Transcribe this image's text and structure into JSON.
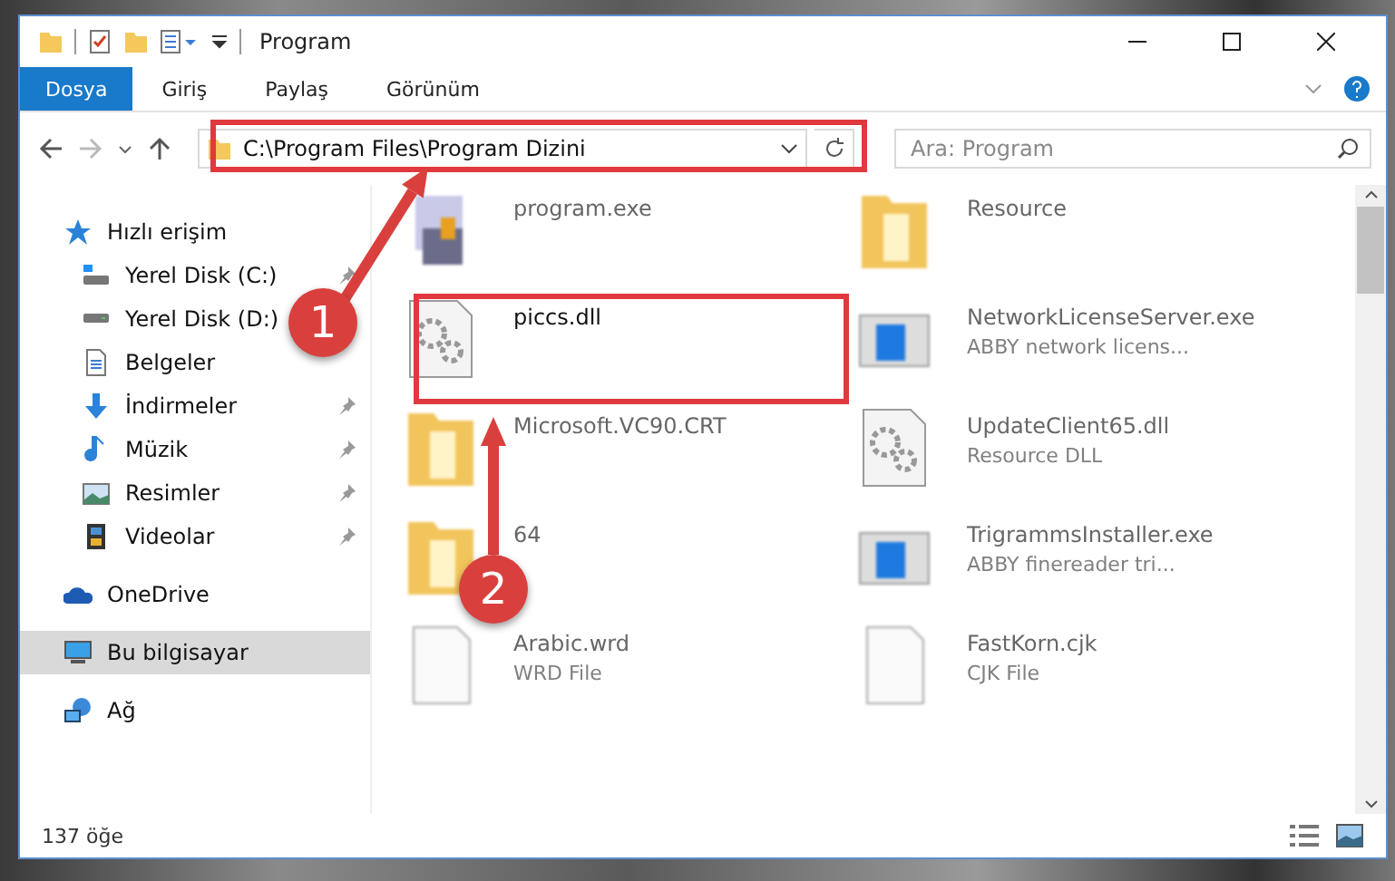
{
  "window": {
    "title": "Program"
  },
  "ribbon_tabs": [
    {
      "label": "Dosya",
      "selected": true
    },
    {
      "label": "Giriş",
      "selected": false
    },
    {
      "label": "Paylaş",
      "selected": false
    },
    {
      "label": "Görünüm",
      "selected": false
    }
  ],
  "address": {
    "path": "C:\\Program Files\\Program Dizini"
  },
  "search": {
    "placeholder": "Ara: Program"
  },
  "sidebar": {
    "items": [
      {
        "label": "Hızlı erişim",
        "kind": "star",
        "selected": false,
        "children": [
          {
            "label": "Yerel Disk (C:)",
            "kind": "system-drive",
            "pinned": true,
            "selected": false
          },
          {
            "label": "Yerel Disk (D:)",
            "kind": "drive",
            "pinned": false,
            "selected": false
          },
          {
            "label": "Belgeler",
            "kind": "documents",
            "pinned": false,
            "selected": false
          },
          {
            "label": "İndirmeler",
            "kind": "download",
            "pinned": true,
            "selected": false
          },
          {
            "label": "Müzik",
            "kind": "music",
            "pinned": true,
            "selected": false
          },
          {
            "label": "Resimler",
            "kind": "pictures",
            "pinned": true,
            "selected": false
          },
          {
            "label": "Videolar",
            "kind": "videos",
            "pinned": true,
            "selected": false
          }
        ]
      },
      {
        "label": "OneDrive",
        "kind": "cloud",
        "selected": false
      },
      {
        "label": "Bu bilgisayar",
        "kind": "computer",
        "selected": true
      },
      {
        "label": "Ağ",
        "kind": "network",
        "selected": false
      }
    ]
  },
  "files": [
    {
      "name": "program.exe",
      "kind": "installer",
      "highlighted": false
    },
    {
      "name": "Resource",
      "kind": "folder",
      "highlighted": false
    },
    {
      "name": "piccs.dll",
      "kind": "dll",
      "highlighted": true
    },
    {
      "name": "NetworkLicenseServer.exe",
      "detail": "ABBY network licens...",
      "kind": "app",
      "highlighted": false
    },
    {
      "name": "Microsoft.VC90.CRT",
      "kind": "folder",
      "highlighted": false
    },
    {
      "name": "UpdateClient65.dll",
      "detail": "Resource DLL",
      "kind": "dll",
      "highlighted": false
    },
    {
      "name": "64",
      "kind": "folder",
      "highlighted": false
    },
    {
      "name": "TrigrammsInstaller.exe",
      "detail": "ABBY finereader tri...",
      "kind": "app",
      "highlighted": false
    },
    {
      "name": "Arabic.wrd",
      "detail": "WRD File",
      "kind": "file",
      "highlighted": false
    },
    {
      "name": "FastKorn.cjk",
      "detail": "CJK File",
      "kind": "file",
      "highlighted": false
    }
  ],
  "annotations": [
    {
      "number": "1"
    },
    {
      "number": "2"
    }
  ],
  "status_bar": {
    "count": "137 öğe"
  }
}
